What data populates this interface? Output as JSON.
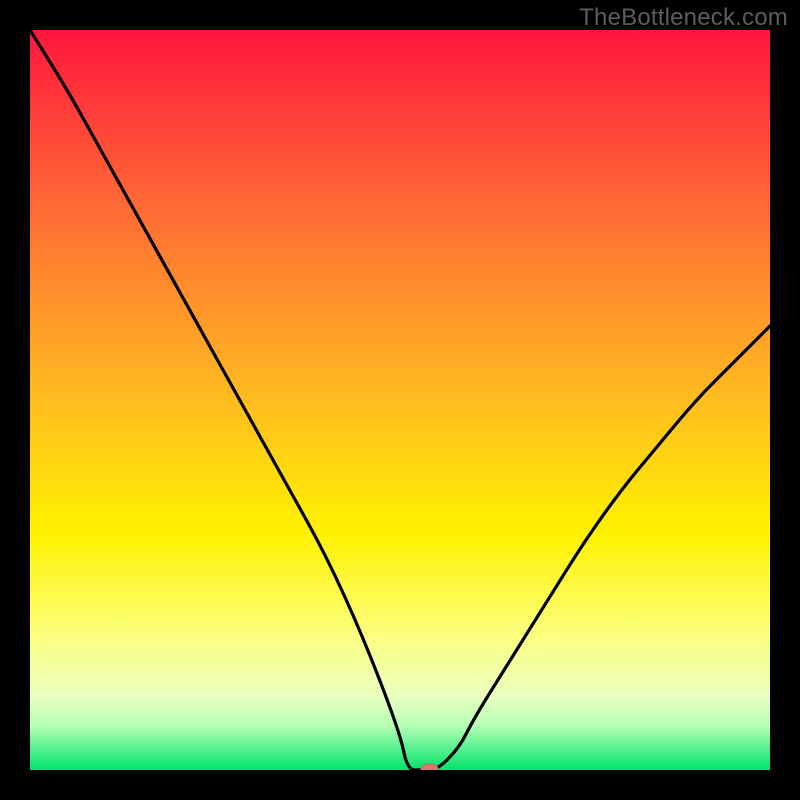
{
  "watermark": "TheBottleneck.com",
  "chart_data": {
    "type": "line",
    "title": "",
    "xlabel": "",
    "ylabel": "",
    "xlim": [
      0,
      100
    ],
    "ylim": [
      0,
      100
    ],
    "grid": false,
    "legend": false,
    "background_gradient": {
      "stops": [
        {
          "y_pct": 0,
          "color": "#ff163d"
        },
        {
          "y_pct": 25,
          "color": "#ff6e34"
        },
        {
          "y_pct": 50,
          "color": "#ffbc20"
        },
        {
          "y_pct": 68,
          "color": "#fff200"
        },
        {
          "y_pct": 82,
          "color": "#fcff81"
        },
        {
          "y_pct": 90,
          "color": "#e9ffc0"
        },
        {
          "y_pct": 94,
          "color": "#b6ffb6"
        },
        {
          "y_pct": 100,
          "color": "#00e46a"
        }
      ]
    },
    "series": [
      {
        "name": "bottleneck-curve",
        "x": [
          0,
          5,
          10,
          15,
          20,
          25,
          30,
          35,
          40,
          45,
          50,
          51,
          53,
          55,
          58,
          60,
          65,
          70,
          75,
          80,
          85,
          90,
          95,
          100
        ],
        "y": [
          100,
          92,
          83,
          74,
          65,
          56,
          47,
          38,
          29,
          18,
          5,
          0,
          0,
          0,
          3,
          7,
          15,
          23,
          31,
          38,
          44,
          50,
          55,
          60
        ]
      }
    ],
    "marker": {
      "name": "optimal-point",
      "x": 54,
      "y": 0,
      "color": "#d47a6f"
    }
  }
}
